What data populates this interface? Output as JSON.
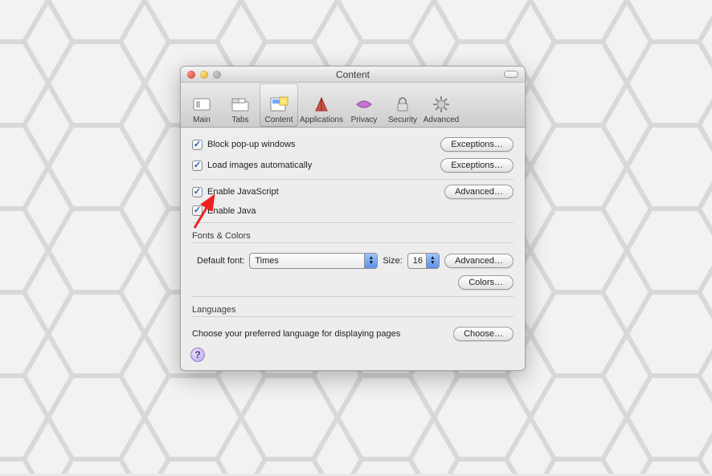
{
  "window": {
    "title": "Content"
  },
  "toolbar": {
    "items": [
      {
        "label": "Main"
      },
      {
        "label": "Tabs"
      },
      {
        "label": "Content"
      },
      {
        "label": "Applications"
      },
      {
        "label": "Privacy"
      },
      {
        "label": "Security"
      },
      {
        "label": "Advanced"
      }
    ]
  },
  "checks": {
    "block_popups": "Block pop-up windows",
    "load_images": "Load images automatically",
    "enable_js": "Enable JavaScript",
    "enable_java": "Enable Java"
  },
  "buttons": {
    "exceptions": "Exceptions…",
    "advanced": "Advanced…",
    "colors": "Colors…",
    "choose": "Choose…"
  },
  "fonts": {
    "section": "Fonts & Colors",
    "default_font_label": "Default font:",
    "default_font_value": "Times",
    "size_label": "Size:",
    "size_value": "16"
  },
  "languages": {
    "section": "Languages",
    "prompt": "Choose your preferred language for displaying pages"
  }
}
